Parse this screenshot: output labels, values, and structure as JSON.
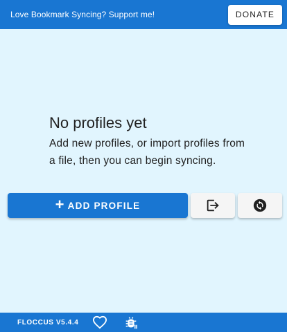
{
  "banner": {
    "support_text": "Love Bookmark Syncing? Support me!",
    "donate_label": "DONATE"
  },
  "empty_state": {
    "title": "No profiles yet",
    "description": "Add new profiles, or import profiles from a file, then you can begin syncing."
  },
  "actions": {
    "add_profile_label": "ADD PROFILE",
    "add_icon": "plus-icon",
    "import_icon": "import-export-icon",
    "sync_icon": "sync-icon"
  },
  "footer": {
    "version": "FLOCCUS V5.4.4",
    "heart_icon": "heart-icon",
    "debug_icon": "bug-report-icon"
  },
  "colors": {
    "primary": "#1976d2",
    "background": "#e1f5fe",
    "button_light": "#f5f5f5"
  }
}
